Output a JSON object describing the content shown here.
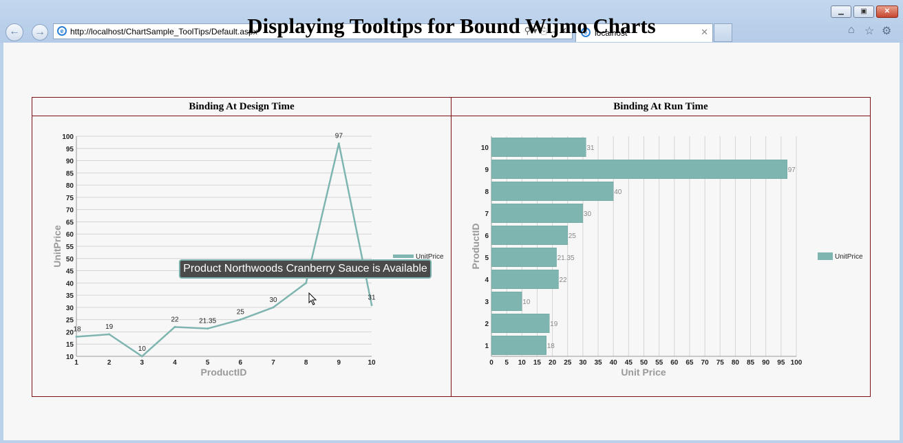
{
  "browser": {
    "url": "http://localhost/ChartSample_ToolTips/Default.aspx",
    "tab_title": "localhost",
    "window_controls": [
      "minimize-icon",
      "restore-icon",
      "close-icon"
    ],
    "right_icons": [
      "home-icon",
      "star-icon",
      "gear-icon"
    ]
  },
  "page": {
    "title": "Displaying Tooltips for Bound Wijmo Charts",
    "col1_header": "Binding At Design Time",
    "col2_header": "Binding At Run Time"
  },
  "tooltip": {
    "text": "Product Northwoods Cranberry Sauce is Available"
  },
  "colors": {
    "series": "#7fb5b0",
    "border": "#7a0f14",
    "tooltip_bg": "#4a4a4a"
  },
  "chart_data": [
    {
      "type": "line",
      "x": [
        "1",
        "2",
        "3",
        "4",
        "5",
        "6",
        "7",
        "8",
        "9",
        "10"
      ],
      "series": [
        {
          "name": "UnitPrice",
          "values": [
            18,
            19,
            10,
            22,
            21.35,
            25,
            30,
            40,
            97,
            31
          ]
        }
      ],
      "data_labels": [
        "18",
        "19",
        "10",
        "22",
        "21.35",
        "25",
        "30",
        "40",
        "97",
        "31"
      ],
      "xlabel": "ProductID",
      "ylabel": "UnitPrice",
      "ylim": [
        10,
        100
      ],
      "yticks": [
        "10",
        "15",
        "20",
        "25",
        "30",
        "35",
        "40",
        "45",
        "50",
        "55",
        "60",
        "65",
        "70",
        "75",
        "80",
        "85",
        "90",
        "95",
        "100"
      ],
      "grid": true,
      "legend": "right"
    },
    {
      "type": "bar",
      "orientation": "horizontal",
      "categories": [
        "1",
        "2",
        "3",
        "4",
        "5",
        "6",
        "7",
        "8",
        "9",
        "10"
      ],
      "series": [
        {
          "name": "UnitPrice",
          "values": [
            18,
            19,
            10,
            22,
            21.35,
            25,
            30,
            40,
            97,
            31
          ]
        }
      ],
      "data_labels": [
        "18",
        "19",
        "10",
        "22",
        "21.35",
        "25",
        "30",
        "40",
        "97",
        "31"
      ],
      "xlabel": "Unit Price",
      "ylabel": "ProductID",
      "xlim": [
        0,
        100
      ],
      "xticks": [
        "0",
        "5",
        "10",
        "15",
        "20",
        "25",
        "30",
        "35",
        "40",
        "45",
        "50",
        "55",
        "60",
        "65",
        "70",
        "75",
        "80",
        "85",
        "90",
        "95",
        "100"
      ],
      "grid": true,
      "legend": "right"
    }
  ]
}
